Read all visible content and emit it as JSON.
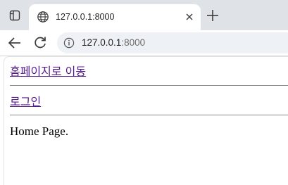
{
  "browser": {
    "tab": {
      "title": "127.0.0.1:8000"
    },
    "address_bar": {
      "host": "127.0.0.1",
      "port": ":8000"
    }
  },
  "page": {
    "links": {
      "home": "홈페이지로 이동",
      "login": "로그인"
    },
    "body_text": "Home Page."
  },
  "colors": {
    "tabstrip_bg": "#dfe3e8",
    "visited_link": "#551a8b",
    "omnibox_bg": "#eef1f5"
  }
}
